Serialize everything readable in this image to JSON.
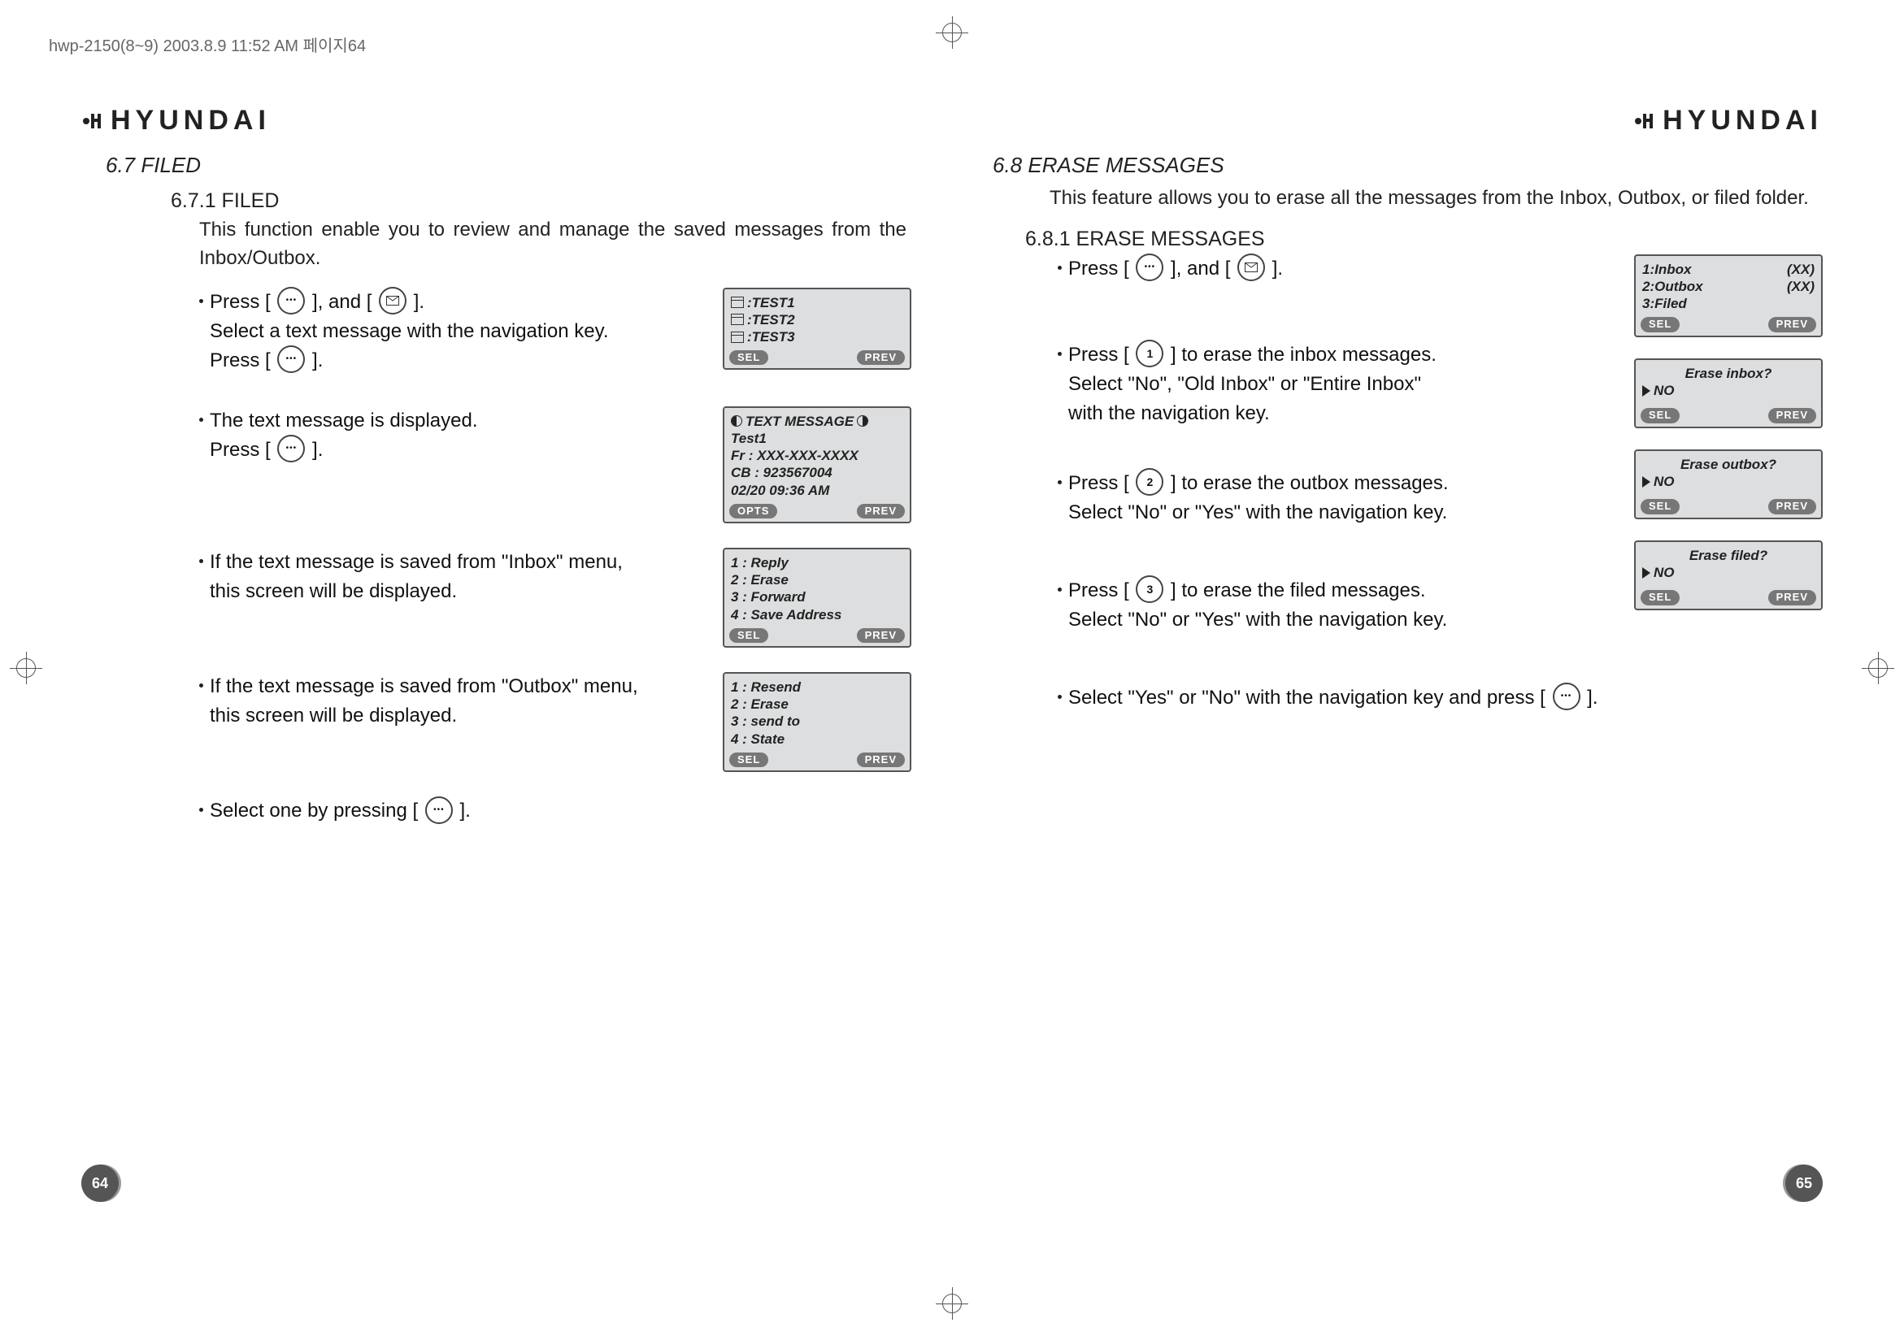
{
  "print_header": "hwp-2150(8~9)  2003.8.9 11:52 AM  페이지64",
  "brand": "HYUNDAI",
  "page_numbers": {
    "left": "64",
    "right": "65"
  },
  "left": {
    "section_num_title": "6.7 FILED",
    "subsection": "6.7.1 FILED",
    "subsection_desc": "This function enable you to review and manage the saved messages from the Inbox/Outbox.",
    "b1_l1a": "Press [ ",
    "b1_l1b": " ], and [ ",
    "b1_l1c": " ].",
    "b1_l2": "Select a text message with the navigation key.",
    "b1_l3a": "Press [ ",
    "b1_l3b": " ].",
    "b2_l1": "The text message is displayed.",
    "b2_l2a": "Press [ ",
    "b2_l2b": " ].",
    "b3_l1": "If the text message is saved from \"Inbox\" menu,",
    "b3_l2": "this screen will be displayed.",
    "b4_l1": "If the text message is saved from \"Outbox\" menu,",
    "b4_l2": "this screen will be displayed.",
    "b5_l1a": "Select one by pressing [ ",
    "b5_l1b": " ]."
  },
  "right": {
    "section_num_title": "6.8 ERASE MESSAGES",
    "section_desc": "This feature allows you to erase all the messages from the Inbox, Outbox, or filed folder.",
    "subsection": "6.8.1 ERASE MESSAGES",
    "b1_a": "Press [ ",
    "b1_b": " ], and [ ",
    "b1_c": " ].",
    "b2_a": "Press [ ",
    "b2_b": " ] to erase the inbox messages.",
    "b2_l2": "Select \"No\", \"Old Inbox\" or \"Entire Inbox\"",
    "b2_l3": "with the navigation key.",
    "b3_a": "Press [ ",
    "b3_b": " ] to erase the outbox messages.",
    "b3_l2": "Select \"No\" or \"Yes\" with the navigation key.",
    "b4_a": "Press [ ",
    "b4_b": " ] to erase the filed messages.",
    "b4_l2": "Select \"No\" or \"Yes\" with the navigation key.",
    "b5_a": "Select \"Yes\" or \"No\" with the navigation key and press [ ",
    "b5_b": " ]."
  },
  "screens": {
    "s1": {
      "l1": ":TEST1",
      "l2": ":TEST2",
      "l3": ":TEST3",
      "sk_l": "SEL",
      "sk_r": "PREV"
    },
    "s2": {
      "title": "TEXT MESSAGE",
      "l1": "Test1",
      "l2": "Fr : XXX-XXX-XXXX",
      "l3": "CB : 923567004",
      "l4": "02/20 09:36 AM",
      "sk_l": "OPTS",
      "sk_r": "PREV"
    },
    "s3": {
      "l1": "1 : Reply",
      "l2": "2 : Erase",
      "l3": "3 : Forward",
      "l4": "4 : Save Address",
      "sk_l": "SEL",
      "sk_r": "PREV"
    },
    "s4": {
      "l1": "1 : Resend",
      "l2": "2 : Erase",
      "l3": "3 : send to",
      "l4": "4 : State",
      "sk_l": "SEL",
      "sk_r": "PREV"
    },
    "r1": {
      "l1a": "1:Inbox",
      "l1b": "(XX)",
      "l2a": "2:Outbox",
      "l2b": "(XX)",
      "l3": "3:Filed",
      "sk_l": "SEL",
      "sk_r": "PREV"
    },
    "r2": {
      "title": "Erase inbox?",
      "answer": "NO",
      "sk_l": "SEL",
      "sk_r": "PREV"
    },
    "r3": {
      "title": "Erase outbox?",
      "answer": "NO",
      "sk_l": "SEL",
      "sk_r": "PREV"
    },
    "r4": {
      "title": "Erase filed?",
      "answer": "NO",
      "sk_l": "SEL",
      "sk_r": "PREV"
    }
  },
  "key_nums": {
    "one": "1",
    "two": "2",
    "three": "3"
  }
}
